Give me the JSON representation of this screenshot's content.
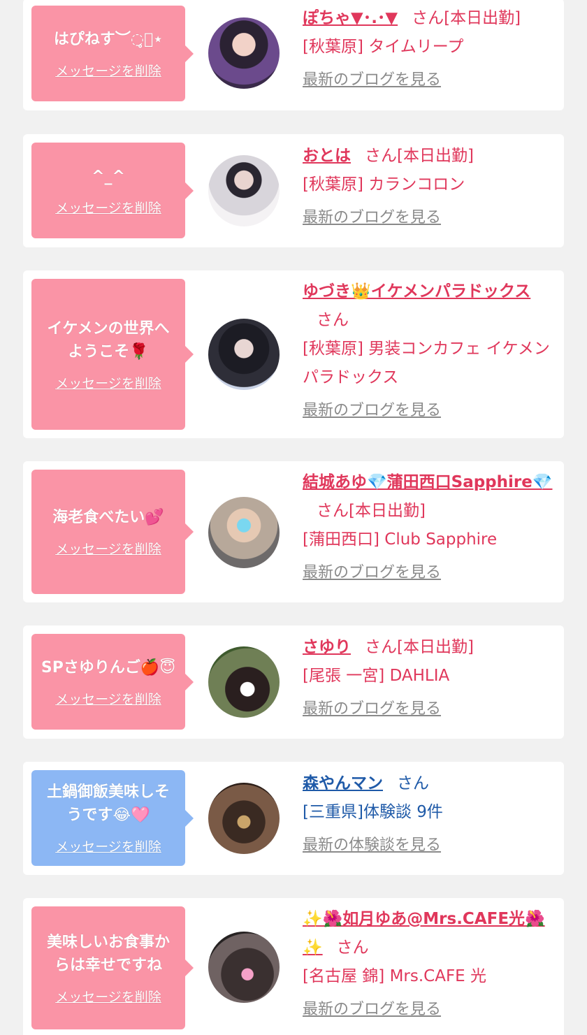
{
  "colors": {
    "background": "#f1f1f1",
    "card": "#ffffff",
    "bubble_pink": "#fa94a6",
    "bubble_blue": "#8cb7f4",
    "name_pink": "#e0375b",
    "name_blue": "#1f5aa8",
    "link_gray": "#8a8a8a"
  },
  "entries": [
    {
      "message": "はぴねす︶◌̥⃝⋆",
      "delete_label": "メッセージを削除",
      "name": "ぽちゃ▼･.･▼",
      "honorific": "さん[本日出勤]",
      "shop": "[秋葉原] タイムリープ",
      "link": "最新のブログを見る",
      "avatar_icon": "avatar-photo"
    },
    {
      "message": "^_^",
      "delete_label": "メッセージを削除",
      "name": "おとは",
      "honorific": "さん[本日出勤]",
      "shop": "[秋葉原] カランコロン",
      "link": "最新のブログを見る",
      "avatar_icon": "avatar-photo"
    },
    {
      "message": "イケメンの世界へようこそ🌹",
      "delete_label": "メッセージを削除",
      "name": "ゆづき👑イケメンパラドックス",
      "honorific": "さん",
      "shop": "[秋葉原] 男装コンカフェ イケメンパラドックス",
      "link": "最新のブログを見る",
      "avatar_icon": "avatar-photo"
    },
    {
      "message": "海老食べたい💕",
      "delete_label": "メッセージを削除",
      "name": "結城あゆ💎蒲田西口Sapphire💎",
      "honorific": "さん[本日出勤]",
      "shop": "[蒲田西口] Club Sapphire",
      "link": "最新のブログを見る",
      "avatar_icon": "avatar-photo"
    },
    {
      "message": "SPさゆりんご🍎😇",
      "delete_label": "メッセージを削除",
      "name": "さゆり",
      "honorific": "さん[本日出勤]",
      "shop": "[尾張 一宮] DAHLIA",
      "link": "最新のブログを見る",
      "avatar_icon": "avatar-photo"
    },
    {
      "message": "土鍋御飯美味しそうです😂🩷",
      "delete_label": "メッセージを削除",
      "name": "森やんマン",
      "honorific": "さん",
      "shop": "[三重県]体験談 9件",
      "link": "最新の体験談を見る",
      "avatar_icon": "avatar-photo"
    },
    {
      "message": "美味しいお食事からは幸せですね",
      "delete_label": "メッセージを削除",
      "name": "✨🌺如月ゆあ@Mrs.CAFE光🌺✨",
      "honorific": "さん",
      "shop": "[名古屋 錦] Mrs.CAFE 光",
      "link": "最新のブログを見る",
      "avatar_icon": "avatar-photo"
    }
  ]
}
